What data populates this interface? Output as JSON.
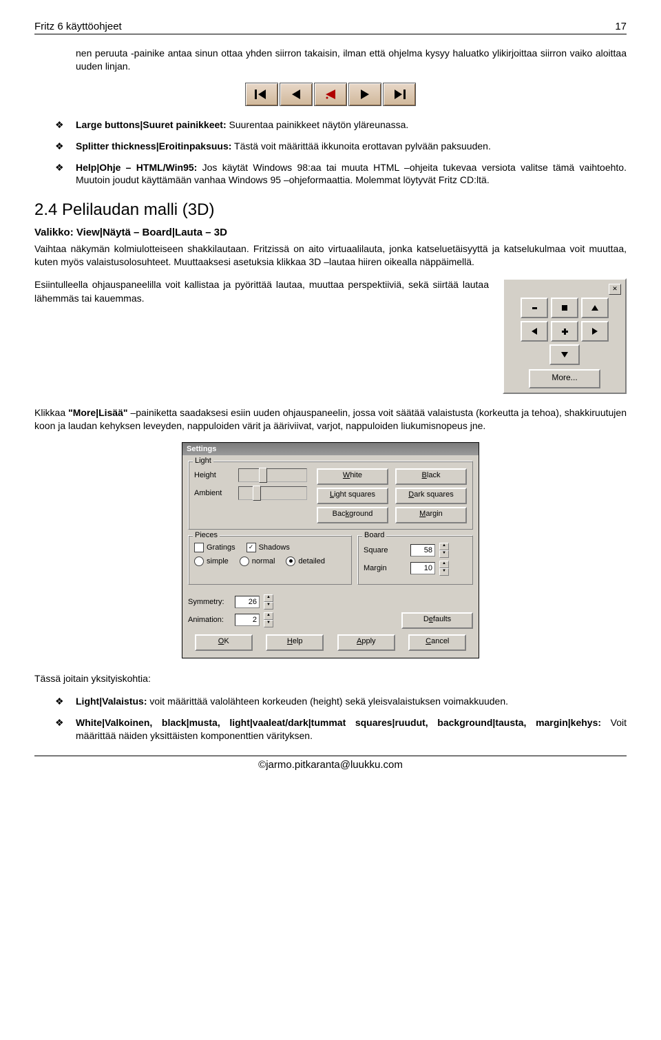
{
  "header": {
    "title": "Fritz 6 käyttöohjeet",
    "page": "17"
  },
  "intro": "nen peruuta -painike antaa sinun ottaa yhden siirron takaisin, ilman että ohjelma kysyy haluatko ylikirjoittaa siirron vaiko aloittaa uuden linjan.",
  "bullets1": [
    {
      "bold": "Large buttons|Suuret painikkeet:",
      "text": " Suurentaa painikkeet näytön yläreunassa."
    },
    {
      "bold": "Splitter thickness|Eroitinpaksuus:",
      "text": " Tästä voit määrittää ikkunoita erottavan pylvään paksuuden."
    },
    {
      "bold": "Help|Ohje – HTML/Win95:",
      "text": " Jos käytät Windows 98:aa tai muuta HTML –ohjeita tukevaa versiota valitse tämä vaihtoehto. Muutoin joudut käyttämään vanhaa Windows 95 –ohjeformaattia. Molemmat löytyvät Fritz CD:ltä."
    }
  ],
  "section": {
    "num": "2.4",
    "title": "Pelilaudan malli (3D)"
  },
  "subhead": "Valikko: View|Näytä – Board|Lauta – 3D",
  "para2": "Vaihtaa näkymän kolmiulotteiseen shakkilautaan. Fritzissä on aito virtuaalilauta, jonka katseluetäisyyttä ja katselukulmaa voit muuttaa, kuten myös valaistusolosuhteet. Muuttaaksesi asetuksia klikkaa 3D –lautaa hiiren oikealla näppäimellä.",
  "panel_desc": "Esiintulleella ohjauspaneelilla voit kallistaa ja pyörittää lautaa, muuttaa perspektiiviä, sekä siirtää lautaa lähemmäs tai kauemmas.",
  "more_label": "More...",
  "para3": "Klikkaa \"More|Lisää\" –painiketta saadaksesi esiin uuden ohjauspaneelin, jossa voit säätää valaistusta (korkeutta ja tehoa), shakkiruutujen koon ja laudan kehyksen leveyden, nappuloiden värit ja ääriviivat, varjot, nappuloiden liukumisnopeus jne.",
  "settings": {
    "title": "Settings",
    "light": {
      "group": "Light",
      "height": "Height",
      "ambient": "Ambient",
      "btns": [
        "White",
        "Black",
        "Light squares",
        "Dark squares",
        "Background",
        "Margin"
      ]
    },
    "pieces": {
      "group": "Pieces",
      "gratings": "Gratings",
      "shadows": "Shadows",
      "opts": [
        "simple",
        "normal",
        "detailed"
      ]
    },
    "board": {
      "group": "Board",
      "square": "Square",
      "square_val": "58",
      "margin": "Margin",
      "margin_val": "10"
    },
    "symmetry": {
      "label": "Symmetry:",
      "val": "26"
    },
    "animation": {
      "label": "Animation:",
      "val": "2"
    },
    "defaults": "Defaults",
    "bottom": [
      "OK",
      "Help",
      "Apply",
      "Cancel"
    ]
  },
  "details_intro": "Tässä joitain yksityiskohtia:",
  "bullets2": [
    {
      "bold": "Light|Valaistus:",
      "text": " voit määrittää valolähteen korkeuden (height) sekä yleisvalaistuksen voimakkuuden."
    },
    {
      "bold": "White|Valkoinen, black|musta, light|vaaleat/dark|tummat squares|ruudut, background|tausta, margin|kehys:",
      "text": " Voit määrittää näiden yksittäisten komponenttien värityksen."
    }
  ],
  "footer": "©jarmo.pitkaranta@luukku.com"
}
